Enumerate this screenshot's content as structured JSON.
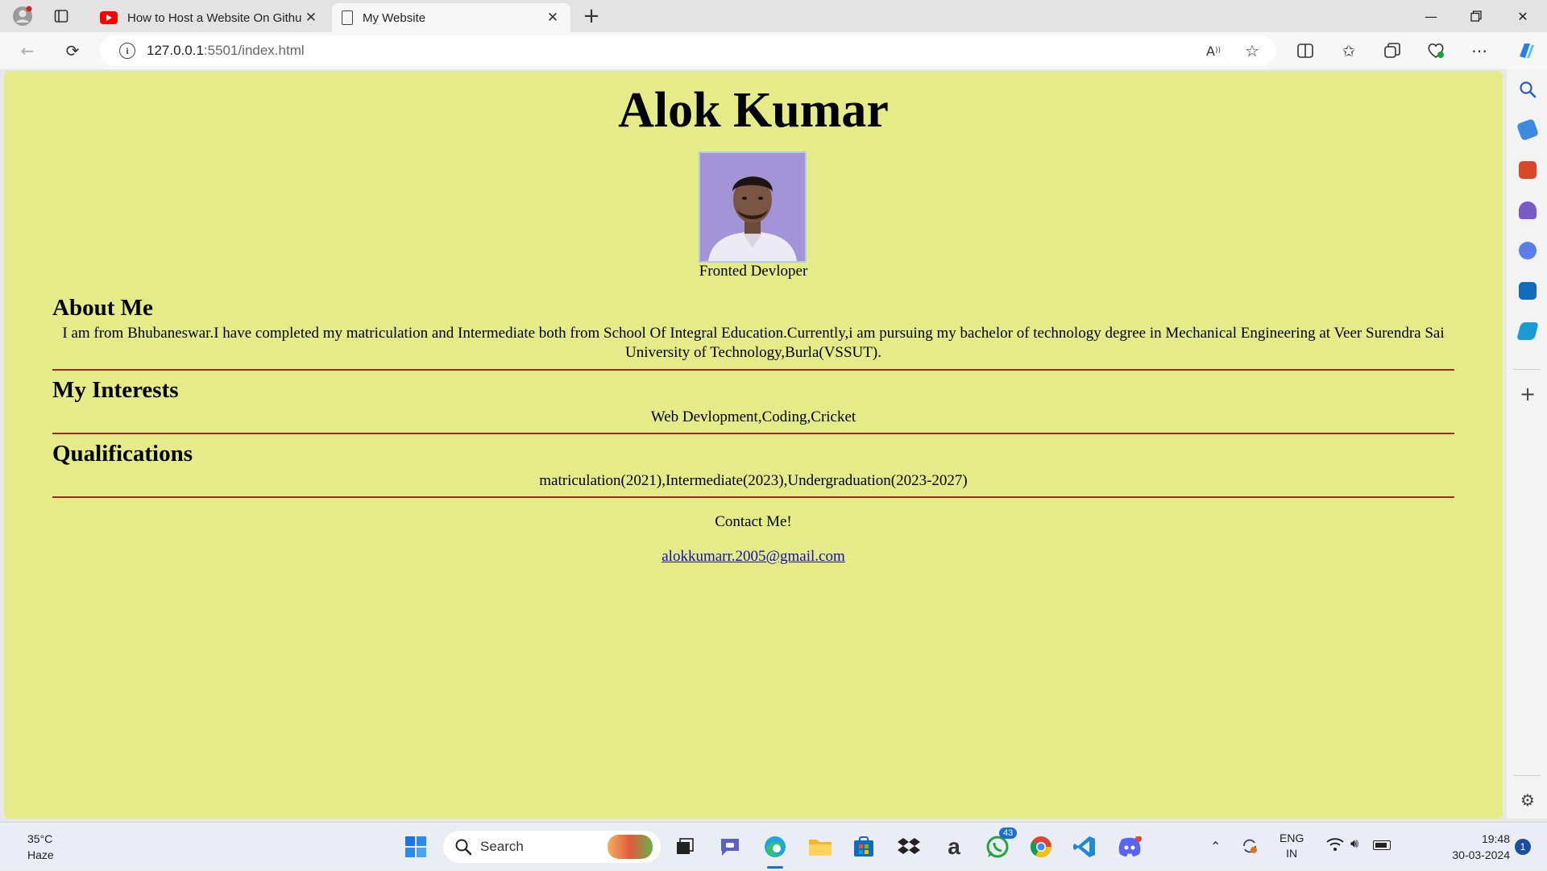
{
  "browser": {
    "tabs": [
      {
        "label": "How to Host a Website On Githu",
        "icon": "youtube-icon",
        "active": false
      },
      {
        "label": "My Website",
        "icon": "document-icon",
        "active": true
      }
    ],
    "new_tab_label": "+",
    "url_host": "127.0.0.1",
    "url_path": ":5501/index.html"
  },
  "page": {
    "name": "Alok Kumar",
    "role": "Fronted Devloper",
    "about_heading": "About Me",
    "about_text": "I am from Bhubaneswar.I have completed my matriculation and Intermediate both from School Of Integral Education.Currently,i am pursuing my bachelor of technology degree in Mechanical Engineering at Veer Surendra Sai University of Technology,Burla(VSSUT).",
    "interests_heading": "My Interests",
    "interests_text": "Web Devlopment,Coding,Cricket",
    "qualifications_heading": "Qualifications",
    "qualifications_text": "matriculation(2021),Intermediate(2023),Undergraduation(2023-2027)",
    "contact_heading": "Contact Me!",
    "email": "alokkumarr.2005@gmail.com",
    "background_color": "#e4eb89",
    "rule_color": "#a52525"
  },
  "taskbar": {
    "weather_temp": "35°C",
    "weather_desc": "Haze",
    "search_placeholder": "Search",
    "whatsapp_badge": "43",
    "language": "ENG",
    "region": "IN",
    "time": "19:48",
    "date": "30-03-2024",
    "notification_count": "1"
  }
}
